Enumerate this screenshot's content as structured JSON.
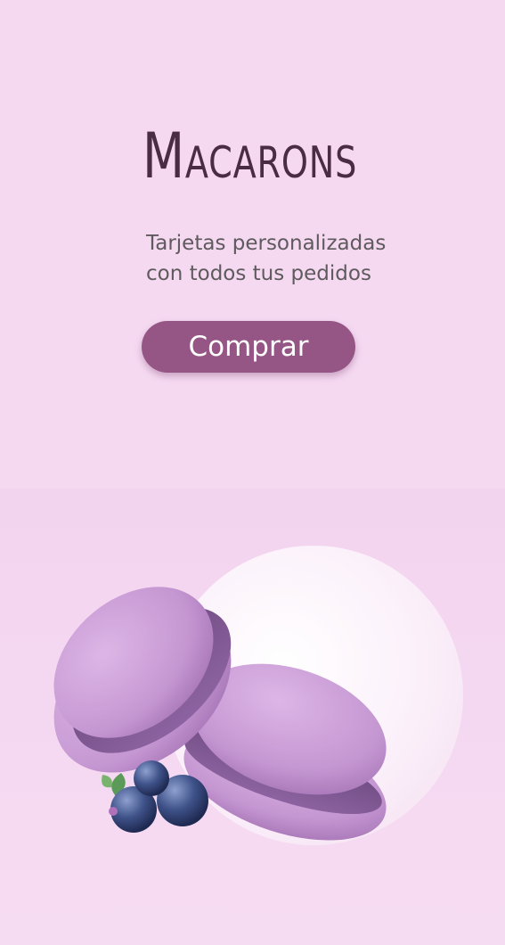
{
  "hero": {
    "title": "Macarons",
    "subtitle_lines": [
      "Tarjetas personalizadas",
      "con todos tus pedidos"
    ],
    "button_label": "Comprar"
  },
  "colors": {
    "background": "#f5d9f1",
    "title": "#4a2c45",
    "button": "#955685",
    "macaron": "#c99ad4",
    "blueberry": "#3d4f85"
  },
  "illustration": {
    "items": [
      "macaron-icon",
      "macaron-icon",
      "blueberry-icon",
      "leaf-icon"
    ]
  }
}
